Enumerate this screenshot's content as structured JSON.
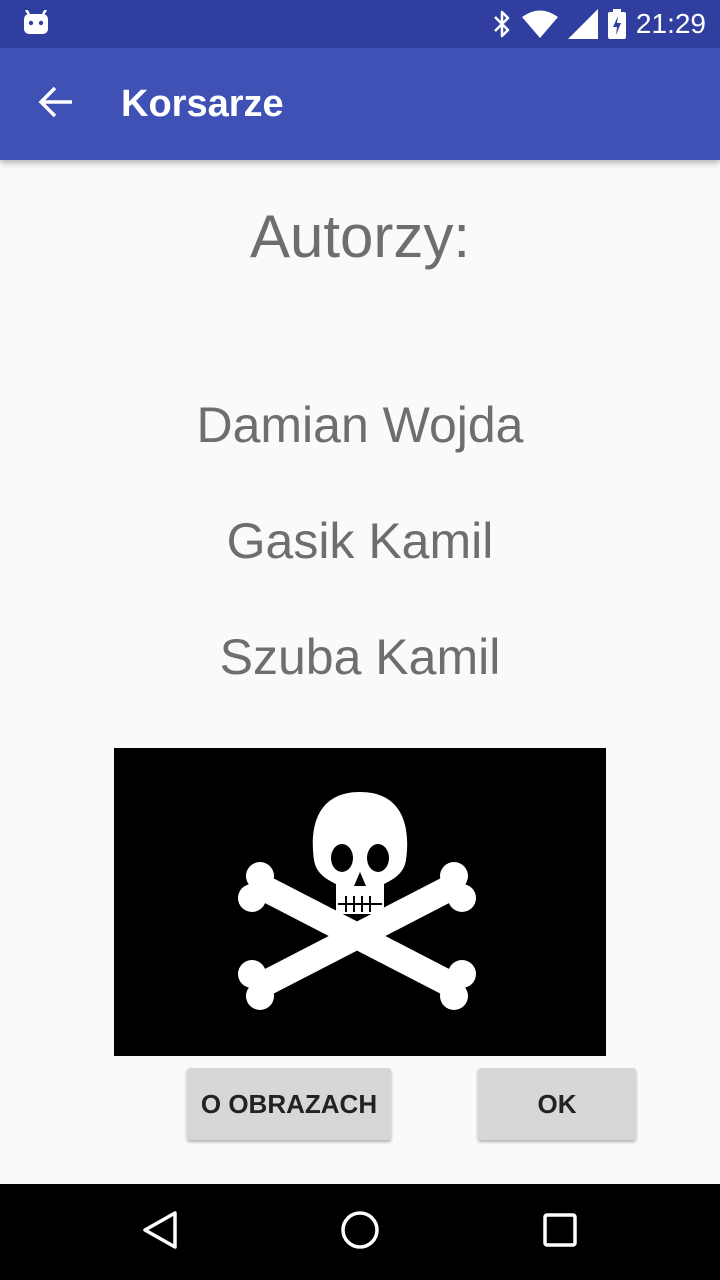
{
  "status_bar": {
    "time": "21:29",
    "icons": [
      "android-debug-icon",
      "bluetooth-icon",
      "wifi-icon",
      "signal-icon",
      "battery-charging-icon"
    ]
  },
  "app_bar": {
    "title": "Korsarze",
    "back_icon": "arrow-back-icon"
  },
  "main": {
    "heading": "Autorzy:",
    "authors": [
      "Damian Wojda",
      "Gasik Kamil",
      "Szuba Kamil"
    ],
    "image": "jolly-roger-flag"
  },
  "buttons": {
    "about_images": "O OBRAZACH",
    "ok": "OK"
  },
  "nav_bar": {
    "icons": [
      "back-triangle-icon",
      "home-circle-icon",
      "recents-square-icon"
    ]
  },
  "colors": {
    "status_bar": "#303f9f",
    "app_bar": "#3f51b5",
    "background": "#fafafa",
    "text": "#6e6e6e",
    "button": "#d6d7d7"
  }
}
